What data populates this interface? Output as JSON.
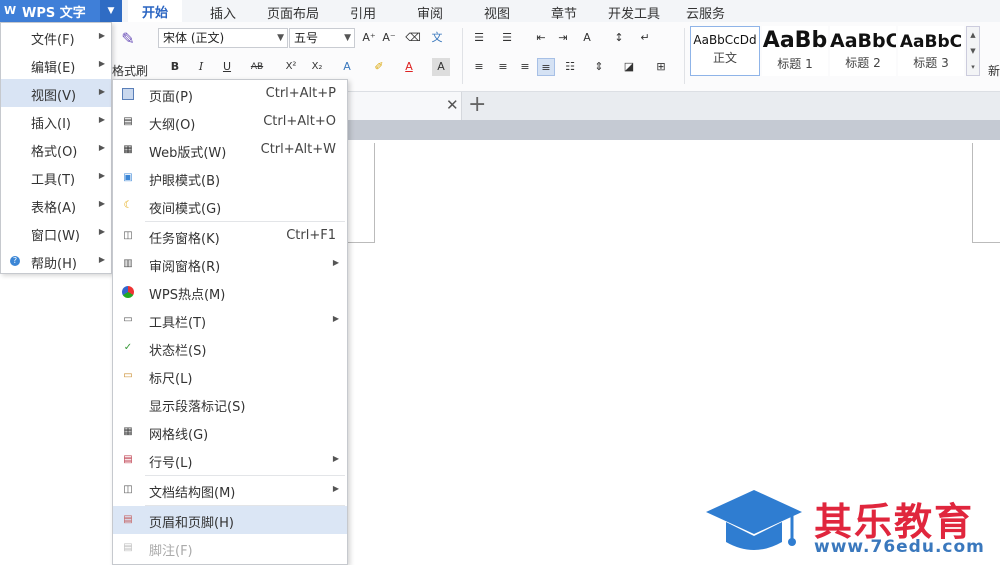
{
  "app": {
    "title": "WPS 文字"
  },
  "tabs": [
    "开始",
    "插入",
    "页面布局",
    "引用",
    "审阅",
    "视图",
    "章节",
    "开发工具",
    "云服务"
  ],
  "ribbon": {
    "format_painter": "格式刷",
    "font_name": "宋体 (正文)",
    "font_size": "五号",
    "bold": "B",
    "italic": "I",
    "underline": "U",
    "strike": "AB",
    "superscript": "X²",
    "subscript": "X₂",
    "styles": [
      {
        "preview": "AaBbCcDd",
        "name": "正文"
      },
      {
        "preview": "AaBb",
        "name": "标题 1"
      },
      {
        "preview": "AaBbC",
        "name": "标题 2"
      },
      {
        "preview": "AaBbC",
        "name": "标题 3"
      }
    ],
    "new_style": "新"
  },
  "menu": {
    "items": [
      {
        "label": "文件(F)"
      },
      {
        "label": "编辑(E)"
      },
      {
        "label": "视图(V)"
      },
      {
        "label": "插入(I)"
      },
      {
        "label": "格式(O)"
      },
      {
        "label": "工具(T)"
      },
      {
        "label": "表格(A)"
      },
      {
        "label": "窗口(W)"
      },
      {
        "label": "帮助(H)"
      }
    ]
  },
  "submenu": {
    "items": [
      {
        "label": "页面(P)",
        "shortcut": "Ctrl+Alt+P"
      },
      {
        "label": "大纲(O)",
        "shortcut": "Ctrl+Alt+O"
      },
      {
        "label": "Web版式(W)",
        "shortcut": "Ctrl+Alt+W"
      },
      {
        "label": "护眼模式(B)",
        "shortcut": ""
      },
      {
        "label": "夜间模式(G)",
        "shortcut": ""
      },
      {
        "label": "任务窗格(K)",
        "shortcut": "Ctrl+F1"
      },
      {
        "label": "审阅窗格(R)",
        "shortcut": ""
      },
      {
        "label": "WPS热点(M)",
        "shortcut": ""
      },
      {
        "label": "工具栏(T)",
        "shortcut": ""
      },
      {
        "label": "状态栏(S)",
        "shortcut": ""
      },
      {
        "label": "标尺(L)",
        "shortcut": ""
      },
      {
        "label": "显示段落标记(S)",
        "shortcut": ""
      },
      {
        "label": "网格线(G)",
        "shortcut": ""
      },
      {
        "label": "行号(L)",
        "shortcut": ""
      },
      {
        "label": "文档结构图(M)",
        "shortcut": ""
      },
      {
        "label": "页眉和页脚(H)",
        "shortcut": ""
      },
      {
        "label": "脚注(F)",
        "shortcut": ""
      }
    ]
  },
  "watermark": {
    "brand": "其乐教育",
    "url": "www.76edu.com"
  },
  "colors": {
    "accent": "#3f7fd8",
    "highlight": "#dbe6f5",
    "watermark_red": "#e0263d",
    "watermark_blue": "#3a78bd"
  }
}
